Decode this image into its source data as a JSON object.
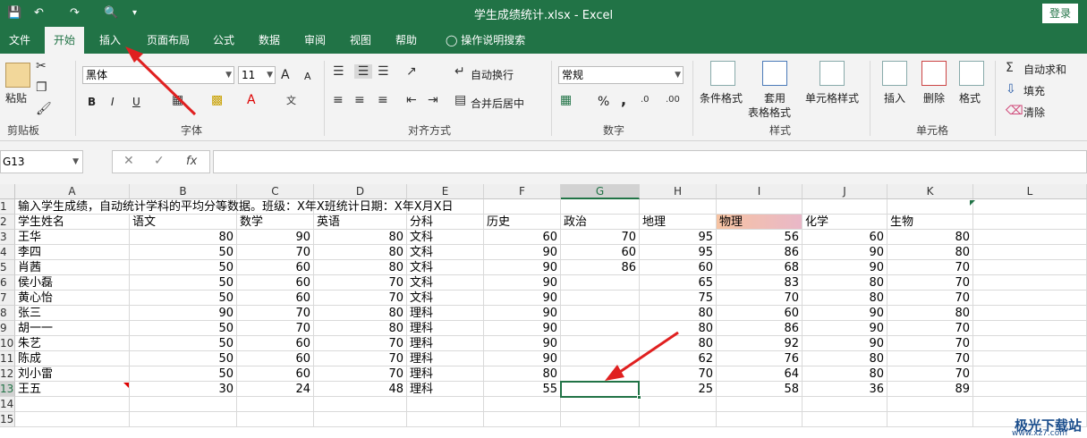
{
  "window": {
    "title": "学生成绩统计.xlsx  -  Excel",
    "login": "登录"
  },
  "tabs": [
    "文件",
    "开始",
    "插入",
    "页面布局",
    "公式",
    "数据",
    "审阅",
    "视图",
    "帮助",
    "操作说明搜索"
  ],
  "ribbon": {
    "clipboard": {
      "label": "剪贴板",
      "paste": "粘贴"
    },
    "font": {
      "label": "字体",
      "name": "黑体",
      "size": "11",
      "bold": "B",
      "italic": "I",
      "underline": "U",
      "grow": "A",
      "shrink": "A"
    },
    "align": {
      "label": "对齐方式",
      "wrap": "自动换行",
      "merge": "合并后居中"
    },
    "number": {
      "label": "数字",
      "format": "常规",
      "percent": "%",
      "comma": ","
    },
    "styles": {
      "label": "样式",
      "cond": "条件格式",
      "table1": "套用",
      "table2": "表格格式",
      "cellstyle": "单元格样式"
    },
    "cells": {
      "label": "单元格",
      "insert": "插入",
      "delete": "删除",
      "format": "格式"
    },
    "editing": {
      "autosum": "自动求和",
      "fill": "填充",
      "clear": "清除"
    }
  },
  "formula": {
    "namebox": "G13",
    "fx": "fx",
    "value": ""
  },
  "sheet": {
    "columns": [
      "A",
      "B",
      "C",
      "D",
      "E",
      "F",
      "G",
      "H",
      "I",
      "J",
      "K",
      "L"
    ],
    "rows": [
      "1",
      "2",
      "3",
      "4",
      "5",
      "6",
      "7",
      "8",
      "9",
      "10",
      "11",
      "12",
      "13",
      "14",
      "15"
    ],
    "row1": "输入学生成绩，自动统计学科的平均分等数据。班级：X年X班统计日期：X年X月X日",
    "headers": [
      "学生姓名",
      "语文",
      "数学",
      "英语",
      "分科",
      "历史",
      "政治",
      "地理",
      "物理",
      "化学",
      "生物"
    ],
    "data": [
      [
        "王华",
        "80",
        "90",
        "80",
        "文科",
        "60",
        "70",
        "95",
        "56",
        "60",
        "80"
      ],
      [
        "李四",
        "50",
        "70",
        "80",
        "文科",
        "90",
        "60",
        "95",
        "86",
        "90",
        "80"
      ],
      [
        "肖茜",
        "50",
        "60",
        "80",
        "文科",
        "90",
        "86",
        "60",
        "68",
        "90",
        "70"
      ],
      [
        "侯小磊",
        "50",
        "60",
        "70",
        "文科",
        "90",
        "",
        "65",
        "83",
        "80",
        "70"
      ],
      [
        "黄心怡",
        "50",
        "60",
        "70",
        "文科",
        "90",
        "",
        "75",
        "70",
        "80",
        "70"
      ],
      [
        "张三",
        "90",
        "70",
        "80",
        "理科",
        "90",
        "",
        "80",
        "60",
        "90",
        "80"
      ],
      [
        "胡一一",
        "50",
        "70",
        "80",
        "理科",
        "90",
        "",
        "80",
        "86",
        "90",
        "70"
      ],
      [
        "朱艺",
        "50",
        "60",
        "70",
        "理科",
        "90",
        "",
        "80",
        "92",
        "90",
        "70"
      ],
      [
        "陈成",
        "50",
        "60",
        "70",
        "理科",
        "90",
        "",
        "62",
        "76",
        "80",
        "70"
      ],
      [
        "刘小雷",
        "50",
        "60",
        "70",
        "理科",
        "80",
        "",
        "70",
        "64",
        "80",
        "70"
      ],
      [
        "王五",
        "30",
        "24",
        "48",
        "理科",
        "55",
        "",
        "25",
        "58",
        "36",
        "89"
      ]
    ]
  },
  "watermark": {
    "brand": "极光下载站",
    "url": "www.xz7.com"
  },
  "colors": {
    "accent": "#217346",
    "arrow": "#e02020"
  }
}
